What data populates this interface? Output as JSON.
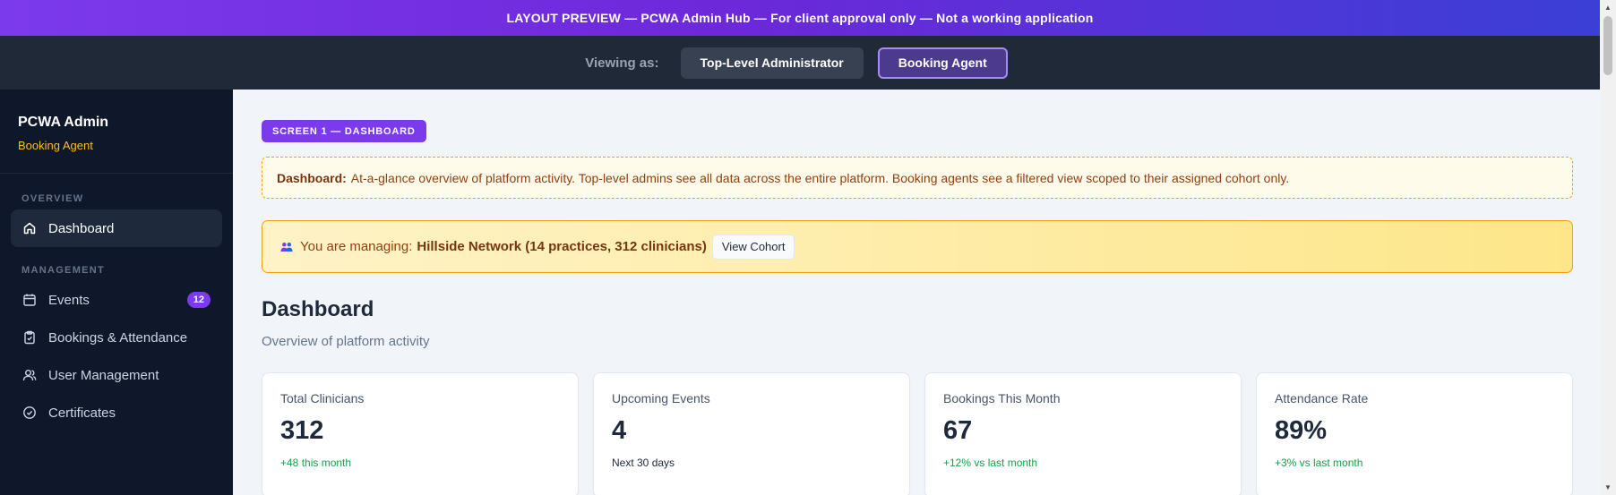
{
  "banner": {
    "text": "LAYOUT PREVIEW — PCWA Admin Hub — For client approval only — Not a working application"
  },
  "role_switcher": {
    "label": "Viewing as:",
    "options": [
      {
        "label": "Top-Level Administrator",
        "active": false
      },
      {
        "label": "Booking Agent",
        "active": true
      }
    ]
  },
  "sidebar": {
    "title": "PCWA Admin",
    "role": "Booking Agent",
    "sections": [
      {
        "heading": "OVERVIEW",
        "items": [
          {
            "label": "Dashboard",
            "icon": "home-icon",
            "active": true
          }
        ]
      },
      {
        "heading": "MANAGEMENT",
        "items": [
          {
            "label": "Events",
            "icon": "calendar-icon",
            "badge": "12"
          },
          {
            "label": "Bookings & Attendance",
            "icon": "clipboard-icon"
          },
          {
            "label": "User Management",
            "icon": "users-icon"
          },
          {
            "label": "Certificates",
            "icon": "check-circle-icon"
          }
        ]
      }
    ]
  },
  "main": {
    "screen_tag": "SCREEN 1 — DASHBOARD",
    "note": {
      "label": "Dashboard:",
      "text": "At-a-glance overview of platform activity. Top-level admins see all data across the entire platform. Booking agents see a filtered view scoped to their assigned cohort only."
    },
    "cohort": {
      "icon": "people-icon",
      "prefix": "You are managing:",
      "name": "Hillside Network (14 practices, 312 clinicians)",
      "button": "View Cohort"
    },
    "title": "Dashboard",
    "subtitle": "Overview of platform activity",
    "stats": [
      {
        "label": "Total Clinicians",
        "value": "312",
        "trend": "+48 this month",
        "trend_type": "up"
      },
      {
        "label": "Upcoming Events",
        "value": "4",
        "trend": "Next 30 days",
        "trend_type": "neutral"
      },
      {
        "label": "Bookings This Month",
        "value": "67",
        "trend": "+12% vs last month",
        "trend_type": "up"
      },
      {
        "label": "Attendance Rate",
        "value": "89%",
        "trend": "+3% vs last month",
        "trend_type": "up"
      }
    ]
  },
  "colors": {
    "accent": "#7c3aed",
    "sidebar_bg": "#0f172a",
    "warning_border": "#f59e0b",
    "trend_up": "#16a34a"
  }
}
